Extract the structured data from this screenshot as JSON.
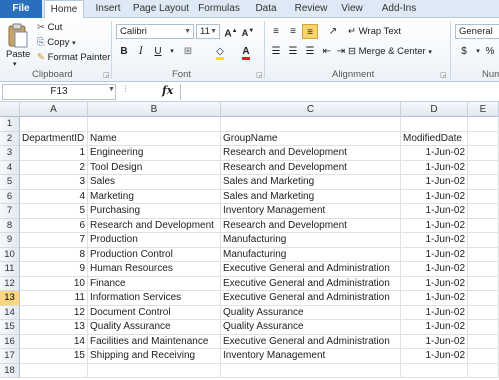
{
  "tabs": [
    "File",
    "Home",
    "Insert",
    "Page Layout",
    "Formulas",
    "Data",
    "Review",
    "View",
    "Add-Ins"
  ],
  "ribbon": {
    "clipboard": {
      "paste": "Paste",
      "cut": "Cut",
      "copy": "Copy",
      "format_painter": "Format Painter",
      "label": "Clipboard"
    },
    "font": {
      "name": "Calibri",
      "size": "11",
      "label": "Font"
    },
    "alignment": {
      "wrap_text": "Wrap Text",
      "merge_center": "Merge & Center",
      "label": "Alignment"
    },
    "number": {
      "format": "General",
      "currency": "$",
      "percent": "%",
      "label": "Num"
    }
  },
  "formula_bar": {
    "name_box": "F13",
    "fx": "fx",
    "value": ""
  },
  "columns": [
    "A",
    "B",
    "C",
    "D",
    "E"
  ],
  "rows": [
    [
      "1",
      "",
      "",
      "",
      ""
    ],
    [
      "2",
      "DepartmentID",
      "Name",
      "GroupName",
      "ModifiedDate"
    ],
    [
      "3",
      "1",
      "Engineering",
      "Research and Development",
      "1-Jun-02"
    ],
    [
      "4",
      "2",
      "Tool Design",
      "Research and Development",
      "1-Jun-02"
    ],
    [
      "5",
      "3",
      "Sales",
      "Sales and Marketing",
      "1-Jun-02"
    ],
    [
      "6",
      "4",
      "Marketing",
      "Sales and Marketing",
      "1-Jun-02"
    ],
    [
      "7",
      "5",
      "Purchasing",
      "Inventory Management",
      "1-Jun-02"
    ],
    [
      "8",
      "6",
      "Research and Development",
      "Research and Development",
      "1-Jun-02"
    ],
    [
      "9",
      "7",
      "Production",
      "Manufacturing",
      "1-Jun-02"
    ],
    [
      "10",
      "8",
      "Production Control",
      "Manufacturing",
      "1-Jun-02"
    ],
    [
      "11",
      "9",
      "Human Resources",
      "Executive General and Administration",
      "1-Jun-02"
    ],
    [
      "12",
      "10",
      "Finance",
      "Executive General and Administration",
      "1-Jun-02"
    ],
    [
      "13",
      "11",
      "Information Services",
      "Executive General and Administration",
      "1-Jun-02"
    ],
    [
      "14",
      "12",
      "Document Control",
      "Quality Assurance",
      "1-Jun-02"
    ],
    [
      "15",
      "13",
      "Quality Assurance",
      "Quality Assurance",
      "1-Jun-02"
    ],
    [
      "16",
      "14",
      "Facilities and Maintenance",
      "Executive General and Administration",
      "1-Jun-02"
    ],
    [
      "17",
      "15",
      "Shipping and Receiving",
      "Inventory Management",
      "1-Jun-02"
    ],
    [
      "18",
      "",
      "",
      "",
      ""
    ]
  ],
  "selected_row": "13",
  "colors": {
    "file_tab": "#2a6fbd",
    "selected_row_header": "#f8d57e",
    "font_color": "#e02020",
    "highlight": "#ffe000"
  }
}
